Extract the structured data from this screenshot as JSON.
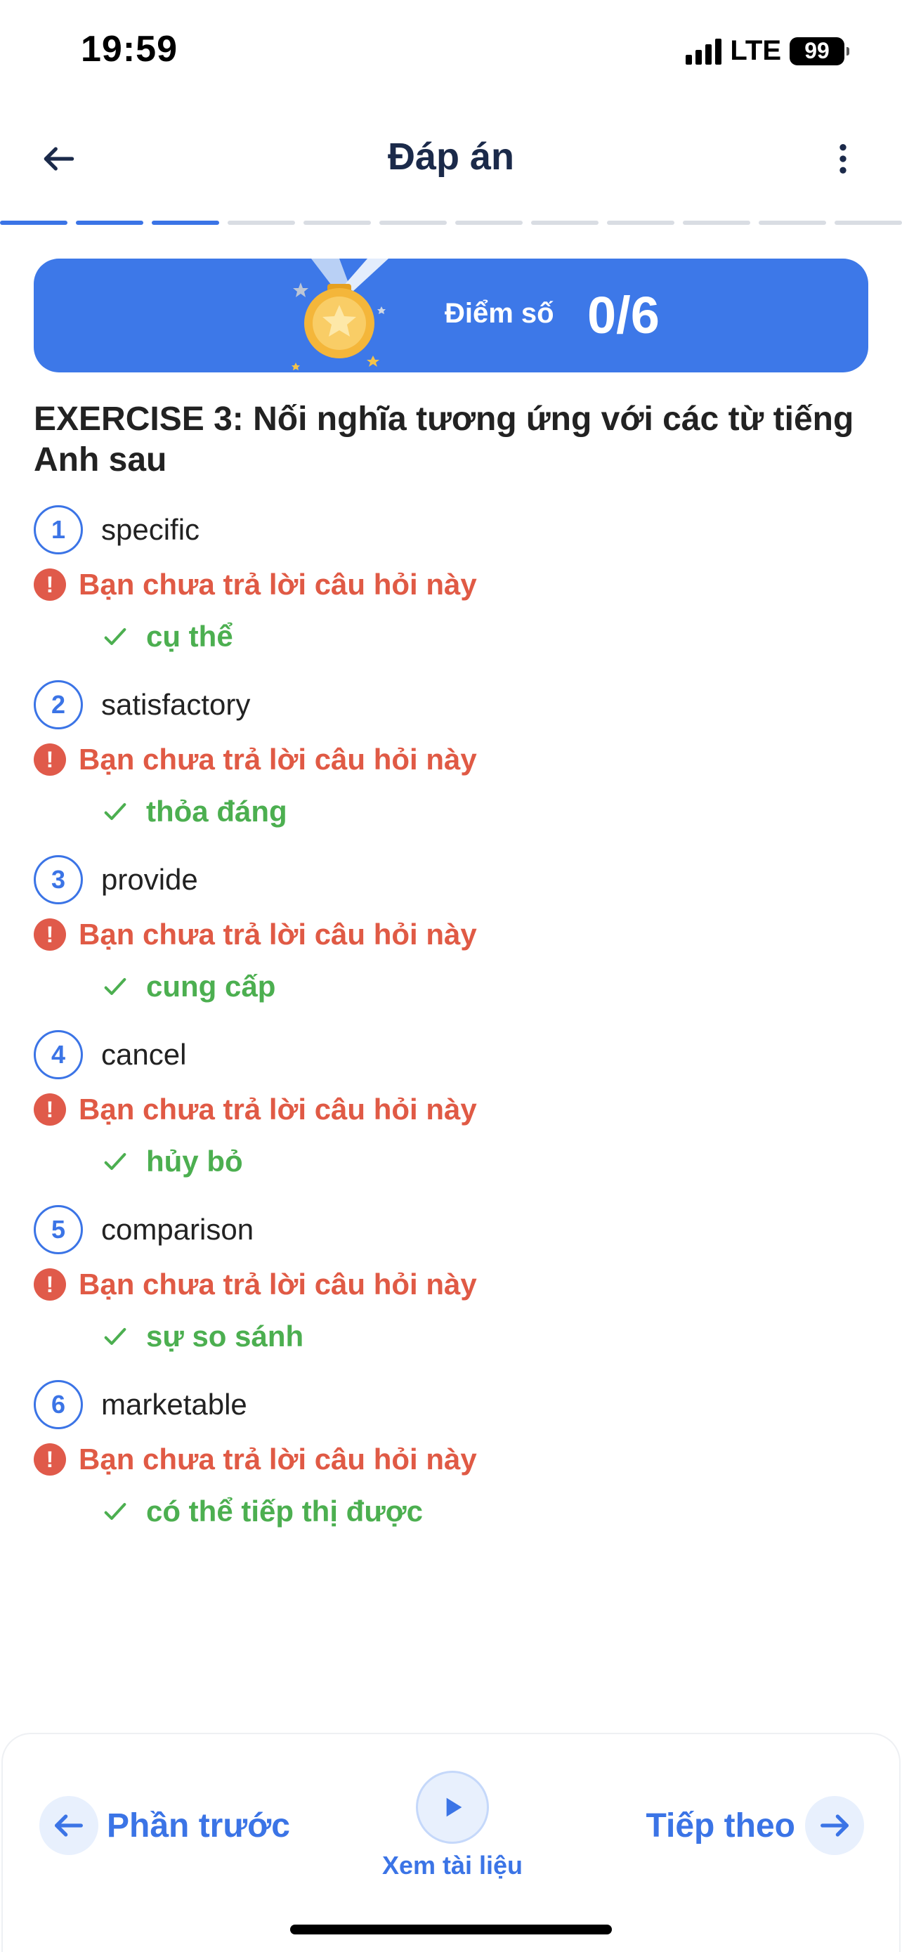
{
  "status_bar": {
    "time": "19:59",
    "network": "LTE",
    "battery": "99"
  },
  "header": {
    "title": "Đáp án",
    "back_icon": "arrow-left-icon",
    "menu_icon": "more-vertical-icon"
  },
  "progress": {
    "total_segments": 12,
    "completed_segments": 3
  },
  "score": {
    "label": "Điểm số",
    "value": "0/6"
  },
  "exercise": {
    "title": "EXERCISE 3: Nối nghĩa tương ứng với các từ tiếng Anh sau"
  },
  "questions": [
    {
      "number": "1",
      "word": "specific",
      "status": "Bạn chưa trả lời câu hỏi này",
      "answer": "cụ thể"
    },
    {
      "number": "2",
      "word": "satisfactory",
      "status": "Bạn chưa trả lời câu hỏi này",
      "answer": "thỏa đáng"
    },
    {
      "number": "3",
      "word": "provide",
      "status": "Bạn chưa trả lời câu hỏi này",
      "answer": "cung cấp"
    },
    {
      "number": "4",
      "word": "cancel",
      "status": "Bạn chưa trả lời câu hỏi này",
      "answer": "hủy bỏ"
    },
    {
      "number": "5",
      "word": "comparison",
      "status": "Bạn chưa trả lời câu hỏi này",
      "answer": "sự so sánh"
    },
    {
      "number": "6",
      "word": "marketable",
      "status": "Bạn chưa trả lời câu hỏi này",
      "answer": "có thể tiếp thị được"
    }
  ],
  "bottom_bar": {
    "prev_label": "Phần trước",
    "docs_label": "Xem tài liệu",
    "next_label": "Tiếp theo"
  },
  "colors": {
    "primary": "#3b74e6",
    "banner": "#3d78e8",
    "error": "#e05a45",
    "success": "#4caf50"
  }
}
